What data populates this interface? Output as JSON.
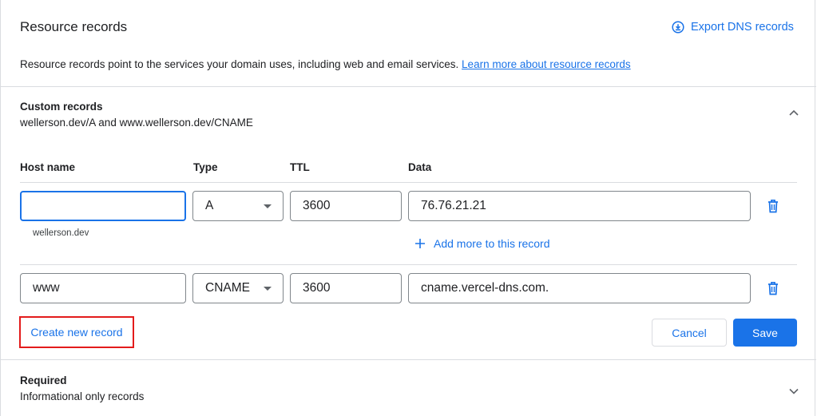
{
  "header": {
    "title": "Resource records",
    "export_label": "Export DNS records",
    "description": "Resource records point to the services your domain uses, including web and email services.",
    "learn_more": "Learn more about resource records"
  },
  "custom": {
    "title": "Custom records",
    "subtitle": "wellerson.dev/A and www.wellerson.dev/CNAME",
    "columns": {
      "host": "Host name",
      "type": "Type",
      "ttl": "TTL",
      "data": "Data"
    },
    "records": [
      {
        "host_value": "",
        "host_hint": "wellerson.dev",
        "type": "A",
        "ttl": "3600",
        "data": "76.76.21.21",
        "add_more": "Add more to this record"
      },
      {
        "host_value": "www",
        "type": "CNAME",
        "ttl": "3600",
        "data": "cname.vercel-dns.com."
      }
    ],
    "create_label": "Create new record",
    "cancel_label": "Cancel",
    "save_label": "Save"
  },
  "required": {
    "title": "Required",
    "subtitle": "Informational only records"
  },
  "colors": {
    "accent": "#1a73e8",
    "highlight": "#e31b1b",
    "divider": "#dadce0"
  }
}
